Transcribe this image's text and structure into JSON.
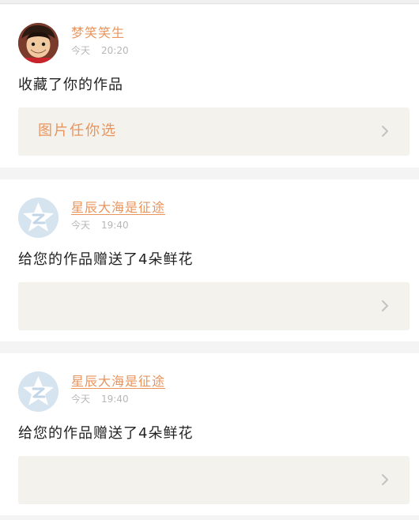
{
  "feed": [
    {
      "username": "梦笑笑生",
      "date_word": "今天",
      "time": "20:20",
      "message": "收藏了你的作品",
      "attachment_label": "图片任你选",
      "avatar": "luffy-avatar"
    },
    {
      "username": "星辰大海是征途",
      "date_word": "今天",
      "time": "19:40",
      "message": "给您的作品赠送了4朵鲜花",
      "attachment_label": "",
      "avatar": "default-qzone-avatar"
    },
    {
      "username": "星辰大海是征途",
      "date_word": "今天",
      "time": "19:40",
      "message": "给您的作品赠送了4朵鲜花",
      "attachment_label": "",
      "avatar": "default-qzone-avatar"
    }
  ],
  "colors": {
    "username": "#e8945d",
    "timestamp": "#b7b7b7",
    "attachment_bg": "#f3f2ec",
    "page_bg": "#f4f4f4"
  },
  "icons": {
    "chevron": "chevron-right-icon"
  }
}
